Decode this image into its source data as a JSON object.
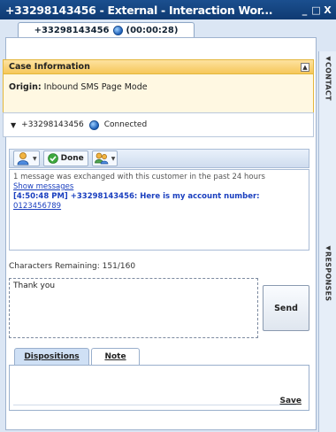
{
  "window": {
    "title": "+33298143456 - External - Interaction Wor...",
    "minimize_glyph": "_",
    "maximize_glyph": "□",
    "close_glyph": "X"
  },
  "interaction_tab": {
    "label": "+33298143456",
    "timer": "(00:00:28)"
  },
  "side_panels": [
    {
      "label": "CONTACT"
    },
    {
      "label": "RESPONSES"
    }
  ],
  "case_info": {
    "header": "Case Information",
    "origin_label": "Origin:",
    "origin_value": "Inbound SMS Page Mode"
  },
  "party": {
    "number": "+33298143456",
    "status": "Connected"
  },
  "toolbar": {
    "done_label": "Done"
  },
  "transcript": {
    "notice": "1 message was exchanged with this customer in the past 24 hours",
    "show_messages": "Show messages",
    "message_prefix": "[4:50:48 PM] +33298143456: Here is my account number:",
    "account_number": "0123456789"
  },
  "composer": {
    "chars_remaining": "Characters Remaining: 151/160",
    "text": "Thank you",
    "send_label": "Send"
  },
  "bottom_tabs": {
    "dispositions": "Dispositions",
    "note": "Note",
    "save_label": "Save"
  },
  "colors": {
    "titlebar": "#1b4f8f",
    "case_header": "#f6c75a",
    "link": "#1a3fbf"
  }
}
